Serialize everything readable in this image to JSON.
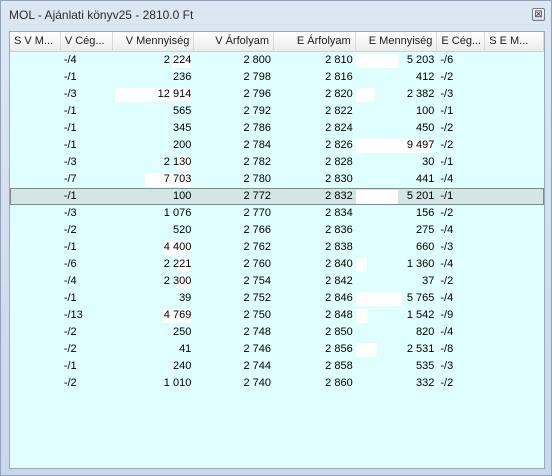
{
  "window": {
    "title": "MOL - Ajánlati könyv25 - 2810.0 Ft",
    "close_glyph": "⊠"
  },
  "columns": [
    "S V M...",
    "V Cég...",
    "V Mennyiség",
    "V Árfolyam",
    "E Árfolyam",
    "E Mennyiség",
    "E Cég...",
    "S E M..."
  ],
  "rows": [
    {
      "v_ceg": "-/4",
      "v_menny": "2 224",
      "v_arf": "2 800",
      "e_arf": "2 810",
      "e_menny": "5 203",
      "e_ceg": "-/6",
      "v_bar": 0.25,
      "e_bar": 0.55
    },
    {
      "v_ceg": "-/1",
      "v_menny": "236",
      "v_arf": "2 798",
      "e_arf": "2 816",
      "e_menny": "412",
      "e_ceg": "-/2",
      "v_bar": 0.0,
      "e_bar": 0.0
    },
    {
      "v_ceg": "-/3",
      "v_menny": "12 914",
      "v_arf": "2 796",
      "e_arf": "2 820",
      "e_menny": "2 382",
      "e_ceg": "-/3",
      "v_bar": 1.0,
      "e_bar": 0.25
    },
    {
      "v_ceg": "-/1",
      "v_menny": "565",
      "v_arf": "2 792",
      "e_arf": "2 822",
      "e_menny": "100",
      "e_ceg": "-/1",
      "v_bar": 0.0,
      "e_bar": 0.0
    },
    {
      "v_ceg": "-/1",
      "v_menny": "345",
      "v_arf": "2 786",
      "e_arf": "2 824",
      "e_menny": "450",
      "e_ceg": "-/2",
      "v_bar": 0.0,
      "e_bar": 0.0
    },
    {
      "v_ceg": "-/1",
      "v_menny": "200",
      "v_arf": "2 784",
      "e_arf": "2 826",
      "e_menny": "9 497",
      "e_ceg": "-/2",
      "v_bar": 0.0,
      "e_bar": 1.0
    },
    {
      "v_ceg": "-/3",
      "v_menny": "2 130",
      "v_arf": "2 782",
      "e_arf": "2 828",
      "e_menny": "30",
      "e_ceg": "-/1",
      "v_bar": 0.18,
      "e_bar": 0.0
    },
    {
      "v_ceg": "-/7",
      "v_menny": "7 703",
      "v_arf": "2 780",
      "e_arf": "2 830",
      "e_menny": "441",
      "e_ceg": "-/4",
      "v_bar": 0.6,
      "e_bar": 0.0
    },
    {
      "v_ceg": "-/1",
      "v_menny": "100",
      "v_arf": "2 772",
      "e_arf": "2 832",
      "e_menny": "5 201",
      "e_ceg": "-/1",
      "v_bar": 0.0,
      "e_bar": 0.55,
      "selected": true
    },
    {
      "v_ceg": "-/3",
      "v_menny": "1 076",
      "v_arf": "2 770",
      "e_arf": "2 834",
      "e_menny": "156",
      "e_ceg": "-/2",
      "v_bar": 0.0,
      "e_bar": 0.0
    },
    {
      "v_ceg": "-/2",
      "v_menny": "520",
      "v_arf": "2 766",
      "e_arf": "2 836",
      "e_menny": "275",
      "e_ceg": "-/4",
      "v_bar": 0.0,
      "e_bar": 0.0
    },
    {
      "v_ceg": "-/1",
      "v_menny": "4 400",
      "v_arf": "2 762",
      "e_arf": "2 838",
      "e_menny": "660",
      "e_ceg": "-/3",
      "v_bar": 0.35,
      "e_bar": 0.0
    },
    {
      "v_ceg": "-/6",
      "v_menny": "2 221",
      "v_arf": "2 760",
      "e_arf": "2 840",
      "e_menny": "1 360",
      "e_ceg": "-/4",
      "v_bar": 0.18,
      "e_bar": 0.15
    },
    {
      "v_ceg": "-/4",
      "v_menny": "2 300",
      "v_arf": "2 754",
      "e_arf": "2 842",
      "e_menny": "37",
      "e_ceg": "-/2",
      "v_bar": 0.18,
      "e_bar": 0.0
    },
    {
      "v_ceg": "-/1",
      "v_menny": "39",
      "v_arf": "2 752",
      "e_arf": "2 846",
      "e_menny": "5 765",
      "e_ceg": "-/4",
      "v_bar": 0.0,
      "e_bar": 0.6
    },
    {
      "v_ceg": "-/13",
      "v_menny": "4 769",
      "v_arf": "2 750",
      "e_arf": "2 848",
      "e_menny": "1 542",
      "e_ceg": "-/9",
      "v_bar": 0.37,
      "e_bar": 0.16
    },
    {
      "v_ceg": "-/2",
      "v_menny": "250",
      "v_arf": "2 748",
      "e_arf": "2 850",
      "e_menny": "820",
      "e_ceg": "-/4",
      "v_bar": 0.0,
      "e_bar": 0.0
    },
    {
      "v_ceg": "-/2",
      "v_menny": "41",
      "v_arf": "2 746",
      "e_arf": "2 856",
      "e_menny": "2 531",
      "e_ceg": "-/8",
      "v_bar": 0.0,
      "e_bar": 0.27
    },
    {
      "v_ceg": "-/1",
      "v_menny": "240",
      "v_arf": "2 744",
      "e_arf": "2 858",
      "e_menny": "535",
      "e_ceg": "-/3",
      "v_bar": 0.0,
      "e_bar": 0.0
    },
    {
      "v_ceg": "-/2",
      "v_menny": "1 010",
      "v_arf": "2 740",
      "e_arf": "2 860",
      "e_menny": "332",
      "e_ceg": "-/2",
      "v_bar": 0.0,
      "e_bar": 0.0
    }
  ],
  "colors": {
    "grid_bg": "#e0ffff",
    "bar": "#ffffff",
    "selected_row": "#d2e6e6"
  }
}
